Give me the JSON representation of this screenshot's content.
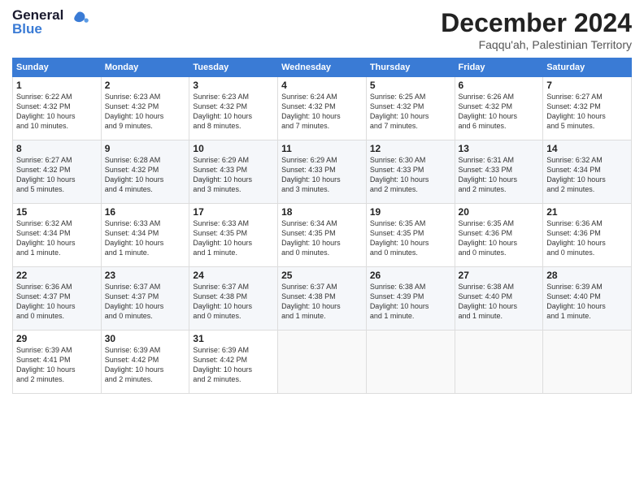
{
  "header": {
    "logo_general": "General",
    "logo_blue": "Blue",
    "month_title": "December 2024",
    "location": "Faqqu'ah, Palestinian Territory"
  },
  "weekdays": [
    "Sunday",
    "Monday",
    "Tuesday",
    "Wednesday",
    "Thursday",
    "Friday",
    "Saturday"
  ],
  "weeks": [
    [
      {
        "day": "1",
        "info": "Sunrise: 6:22 AM\nSunset: 4:32 PM\nDaylight: 10 hours\nand 10 minutes."
      },
      {
        "day": "2",
        "info": "Sunrise: 6:23 AM\nSunset: 4:32 PM\nDaylight: 10 hours\nand 9 minutes."
      },
      {
        "day": "3",
        "info": "Sunrise: 6:23 AM\nSunset: 4:32 PM\nDaylight: 10 hours\nand 8 minutes."
      },
      {
        "day": "4",
        "info": "Sunrise: 6:24 AM\nSunset: 4:32 PM\nDaylight: 10 hours\nand 7 minutes."
      },
      {
        "day": "5",
        "info": "Sunrise: 6:25 AM\nSunset: 4:32 PM\nDaylight: 10 hours\nand 7 minutes."
      },
      {
        "day": "6",
        "info": "Sunrise: 6:26 AM\nSunset: 4:32 PM\nDaylight: 10 hours\nand 6 minutes."
      },
      {
        "day": "7",
        "info": "Sunrise: 6:27 AM\nSunset: 4:32 PM\nDaylight: 10 hours\nand 5 minutes."
      }
    ],
    [
      {
        "day": "8",
        "info": "Sunrise: 6:27 AM\nSunset: 4:32 PM\nDaylight: 10 hours\nand 5 minutes."
      },
      {
        "day": "9",
        "info": "Sunrise: 6:28 AM\nSunset: 4:32 PM\nDaylight: 10 hours\nand 4 minutes."
      },
      {
        "day": "10",
        "info": "Sunrise: 6:29 AM\nSunset: 4:33 PM\nDaylight: 10 hours\nand 3 minutes."
      },
      {
        "day": "11",
        "info": "Sunrise: 6:29 AM\nSunset: 4:33 PM\nDaylight: 10 hours\nand 3 minutes."
      },
      {
        "day": "12",
        "info": "Sunrise: 6:30 AM\nSunset: 4:33 PM\nDaylight: 10 hours\nand 2 minutes."
      },
      {
        "day": "13",
        "info": "Sunrise: 6:31 AM\nSunset: 4:33 PM\nDaylight: 10 hours\nand 2 minutes."
      },
      {
        "day": "14",
        "info": "Sunrise: 6:32 AM\nSunset: 4:34 PM\nDaylight: 10 hours\nand 2 minutes."
      }
    ],
    [
      {
        "day": "15",
        "info": "Sunrise: 6:32 AM\nSunset: 4:34 PM\nDaylight: 10 hours\nand 1 minute."
      },
      {
        "day": "16",
        "info": "Sunrise: 6:33 AM\nSunset: 4:34 PM\nDaylight: 10 hours\nand 1 minute."
      },
      {
        "day": "17",
        "info": "Sunrise: 6:33 AM\nSunset: 4:35 PM\nDaylight: 10 hours\nand 1 minute."
      },
      {
        "day": "18",
        "info": "Sunrise: 6:34 AM\nSunset: 4:35 PM\nDaylight: 10 hours\nand 0 minutes."
      },
      {
        "day": "19",
        "info": "Sunrise: 6:35 AM\nSunset: 4:35 PM\nDaylight: 10 hours\nand 0 minutes."
      },
      {
        "day": "20",
        "info": "Sunrise: 6:35 AM\nSunset: 4:36 PM\nDaylight: 10 hours\nand 0 minutes."
      },
      {
        "day": "21",
        "info": "Sunrise: 6:36 AM\nSunset: 4:36 PM\nDaylight: 10 hours\nand 0 minutes."
      }
    ],
    [
      {
        "day": "22",
        "info": "Sunrise: 6:36 AM\nSunset: 4:37 PM\nDaylight: 10 hours\nand 0 minutes."
      },
      {
        "day": "23",
        "info": "Sunrise: 6:37 AM\nSunset: 4:37 PM\nDaylight: 10 hours\nand 0 minutes."
      },
      {
        "day": "24",
        "info": "Sunrise: 6:37 AM\nSunset: 4:38 PM\nDaylight: 10 hours\nand 0 minutes."
      },
      {
        "day": "25",
        "info": "Sunrise: 6:37 AM\nSunset: 4:38 PM\nDaylight: 10 hours\nand 1 minute."
      },
      {
        "day": "26",
        "info": "Sunrise: 6:38 AM\nSunset: 4:39 PM\nDaylight: 10 hours\nand 1 minute."
      },
      {
        "day": "27",
        "info": "Sunrise: 6:38 AM\nSunset: 4:40 PM\nDaylight: 10 hours\nand 1 minute."
      },
      {
        "day": "28",
        "info": "Sunrise: 6:39 AM\nSunset: 4:40 PM\nDaylight: 10 hours\nand 1 minute."
      }
    ],
    [
      {
        "day": "29",
        "info": "Sunrise: 6:39 AM\nSunset: 4:41 PM\nDaylight: 10 hours\nand 2 minutes."
      },
      {
        "day": "30",
        "info": "Sunrise: 6:39 AM\nSunset: 4:42 PM\nDaylight: 10 hours\nand 2 minutes."
      },
      {
        "day": "31",
        "info": "Sunrise: 6:39 AM\nSunset: 4:42 PM\nDaylight: 10 hours\nand 2 minutes."
      },
      {
        "day": "",
        "info": ""
      },
      {
        "day": "",
        "info": ""
      },
      {
        "day": "",
        "info": ""
      },
      {
        "day": "",
        "info": ""
      }
    ]
  ]
}
